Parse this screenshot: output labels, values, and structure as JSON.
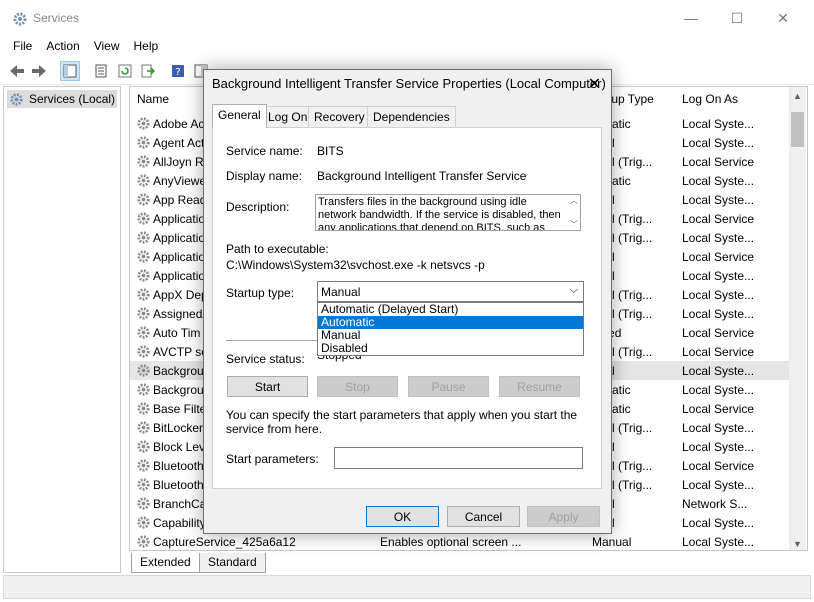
{
  "window": {
    "title": "Services",
    "controls": {
      "minimize": "—",
      "maximize": "☐",
      "close": "✕"
    }
  },
  "menu": [
    "File",
    "Action",
    "View",
    "Help"
  ],
  "tree": {
    "item": "Services (Local)"
  },
  "list": {
    "headers": {
      "name": "Name",
      "startup_type": "rtup Type",
      "log_on_as": "Log On As"
    },
    "rows": [
      {
        "name": "Adobe Ac",
        "desc": "",
        "startup": "tomatic",
        "logon": "Local Syste..."
      },
      {
        "name": "Agent Act",
        "desc": "",
        "startup": "nual",
        "logon": "Local Syste..."
      },
      {
        "name": "AllJoyn Ro",
        "desc": "",
        "startup": "nual (Trig...",
        "logon": "Local Service"
      },
      {
        "name": "AnyViewe",
        "desc": "",
        "startup": "tomatic",
        "logon": "Local Syste..."
      },
      {
        "name": "App Read",
        "desc": "",
        "startup": "nual",
        "logon": "Local Syste..."
      },
      {
        "name": "Applicatio",
        "desc": "",
        "startup": "nual (Trig...",
        "logon": "Local Service"
      },
      {
        "name": "Applicatio",
        "desc": "",
        "startup": "nual (Trig...",
        "logon": "Local Syste..."
      },
      {
        "name": "Applicatio",
        "desc": "",
        "startup": "nual",
        "logon": "Local Service"
      },
      {
        "name": "Applicatio",
        "desc": "",
        "startup": "nual",
        "logon": "Local Syste..."
      },
      {
        "name": "AppX Dep",
        "desc": "",
        "startup": "nual (Trig...",
        "logon": "Local Syste..."
      },
      {
        "name": "AssignedA",
        "desc": "",
        "startup": "nual (Trig...",
        "logon": "Local Syste..."
      },
      {
        "name": "Auto Tim",
        "desc": "",
        "startup": "abled",
        "logon": "Local Service"
      },
      {
        "name": "AVCTP se",
        "desc": "",
        "startup": "nual (Trig...",
        "logon": "Local Service"
      },
      {
        "name": "Backgrou",
        "desc": "",
        "startup": "nual",
        "logon": "Local Syste..."
      },
      {
        "name": "Backgrou",
        "desc": "",
        "startup": "tomatic",
        "logon": "Local Syste..."
      },
      {
        "name": "Base Filte",
        "desc": "",
        "startup": "tomatic",
        "logon": "Local Service"
      },
      {
        "name": "BitLocker",
        "desc": "",
        "startup": "nual (Trig...",
        "logon": "Local Syste..."
      },
      {
        "name": "Block Lev",
        "desc": "",
        "startup": "nual",
        "logon": "Local Syste..."
      },
      {
        "name": "Bluetooth",
        "desc": "",
        "startup": "nual (Trig...",
        "logon": "Local Service"
      },
      {
        "name": "Bluetooth",
        "desc": "",
        "startup": "nual (Trig...",
        "logon": "Local Syste..."
      },
      {
        "name": "BranchCa",
        "desc": "",
        "startup": "nual",
        "logon": "Network S..."
      },
      {
        "name": "Capability",
        "desc": "",
        "startup": "nual",
        "logon": "Local Syste..."
      },
      {
        "name": "CaptureService_425a6a12",
        "desc": "Enables optional screen ...",
        "startup": "Manual",
        "logon": "Local Syste..."
      }
    ]
  },
  "bottom_tabs": [
    "Extended",
    "Standard"
  ],
  "dialog": {
    "title": "Background Intelligent Transfer Service Properties (Local Computer)",
    "tabs": [
      "General",
      "Log On",
      "Recovery",
      "Dependencies"
    ],
    "service_name_label": "Service name:",
    "service_name": "BITS",
    "display_name_label": "Display name:",
    "display_name": "Background Intelligent Transfer Service",
    "description_label": "Description:",
    "description": "Transfers files in the background using idle network bandwidth. If the service is disabled, then any applications that depend on BITS, such as Windows",
    "path_label": "Path to executable:",
    "path": "C:\\Windows\\System32\\svchost.exe -k netsvcs -p",
    "startup_type_label": "Startup type:",
    "startup_type_value": "Manual",
    "startup_options": [
      "Automatic (Delayed Start)",
      "Automatic",
      "Manual",
      "Disabled"
    ],
    "service_status_label": "Service status:",
    "service_status": "Stopped",
    "start_button": "Start",
    "stop_button": "Stop",
    "pause_button": "Pause",
    "resume_button": "Resume",
    "help_text": "You can specify the start parameters that apply when you start the service from here.",
    "start_params_label": "Start parameters:",
    "ok_button": "OK",
    "cancel_button": "Cancel",
    "apply_button": "Apply"
  },
  "colors": {
    "selection": "#0078d7",
    "accent_icon": "#1e7bd6"
  }
}
